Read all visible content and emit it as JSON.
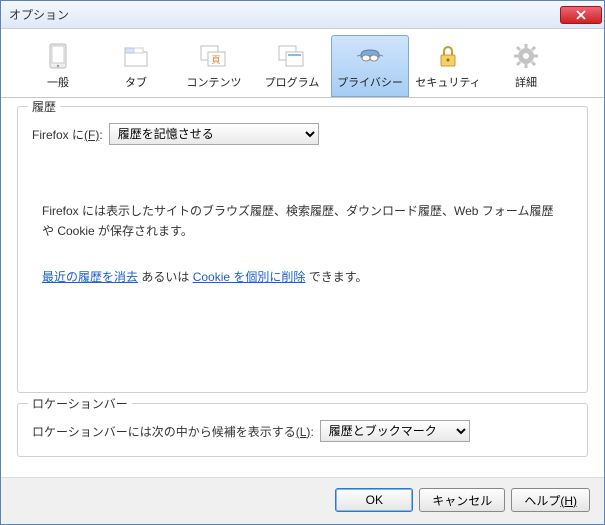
{
  "title": "オプション",
  "toolbar": [
    {
      "id": "general",
      "label": "一般"
    },
    {
      "id": "tabs",
      "label": "タブ"
    },
    {
      "id": "content",
      "label": "コンテンツ"
    },
    {
      "id": "programs",
      "label": "プログラム"
    },
    {
      "id": "privacy",
      "label": "プライバシー",
      "active": true
    },
    {
      "id": "security",
      "label": "セキュリティ"
    },
    {
      "id": "advanced",
      "label": "詳細"
    }
  ],
  "history": {
    "legend": "履歴",
    "prefix": "Firefox に",
    "accel": "(F)",
    "colon": ":",
    "select_value": "履歴を記憶させる",
    "description": "Firefox には表示したサイトのブラウズ履歴、検索履歴、ダウンロード履歴、Web フォーム履歴や Cookie が保存されます。",
    "link1": "最近の履歴を消去",
    "between": " あるいは ",
    "link2": "Cookie を個別に削除",
    "after": " できます。"
  },
  "locationbar": {
    "legend": "ロケーションバー",
    "label": "ロケーションバーには次の中から候補を表示する",
    "accel": "(L)",
    "colon": ":",
    "select_value": "履歴とブックマーク"
  },
  "buttons": {
    "ok": "OK",
    "cancel": "キャンセル",
    "help": "ヘルプ",
    "help_accel": "(H)"
  }
}
